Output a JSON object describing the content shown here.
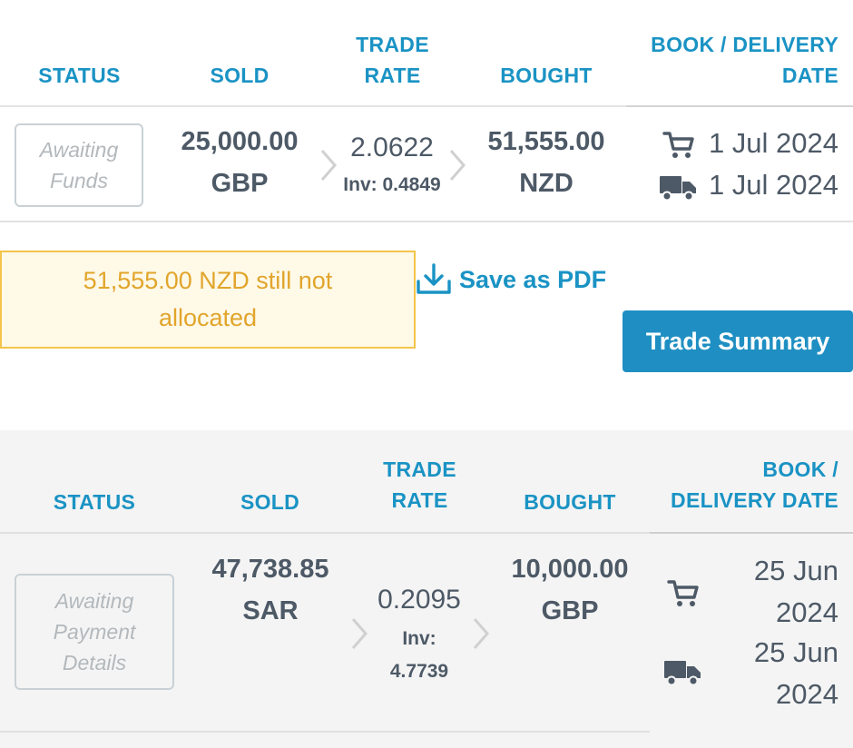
{
  "headers": {
    "status": "STATUS",
    "sold": "SOLD",
    "trade_rate_1": "TRADE",
    "trade_rate_2": "RATE",
    "bought": "BOUGHT",
    "book_delivery_1": "BOOK / DELIVERY",
    "book_delivery_2": "DATE"
  },
  "headers2": {
    "status": "STATUS",
    "sold": "SOLD",
    "trade_rate_1": "TRADE",
    "trade_rate_2": "RATE",
    "bought": "BOUGHT",
    "book_delivery_1": "BOOK /",
    "book_delivery_2": "DELIVERY DATE"
  },
  "trades": [
    {
      "status_line1": "Awaiting",
      "status_line2": "Funds",
      "sold_amount": "25,000.00",
      "sold_currency": "GBP",
      "rate": "2.0622",
      "inv": "Inv: 0.4849",
      "bought_amount": "51,555.00",
      "bought_currency": "NZD",
      "book_date": "1 Jul 2024",
      "delivery_date": "1 Jul 2024"
    },
    {
      "status_line1": "Awaiting",
      "status_line2": "Payment",
      "status_line3": "Details",
      "sold_amount": "47,738.85",
      "sold_currency": "SAR",
      "rate": "0.2095",
      "inv_label": "Inv:",
      "inv_value": "4.7739",
      "bought_amount": "10,000.00",
      "bought_currency": "GBP",
      "book_date_1": "25 Jun",
      "book_date_2": "2024",
      "delivery_date_1": "25 Jun",
      "delivery_date_2": "2024"
    }
  ],
  "notice": {
    "line1": "51,555.00 NZD still not",
    "line2": "allocated"
  },
  "actions": {
    "save_pdf": "Save as PDF",
    "trade_summary": "Trade Summary"
  },
  "icons": {
    "book": "cart-icon",
    "delivery": "truck-icon",
    "download": "download-icon",
    "chevron": "chevron-right-icon"
  },
  "colors": {
    "accent": "#1a93c4",
    "button": "#1f8fc3",
    "warning_text": "#e1a52b",
    "warning_border": "#f3c54b",
    "text": "#4d5966",
    "muted": "#b3b8bc"
  }
}
